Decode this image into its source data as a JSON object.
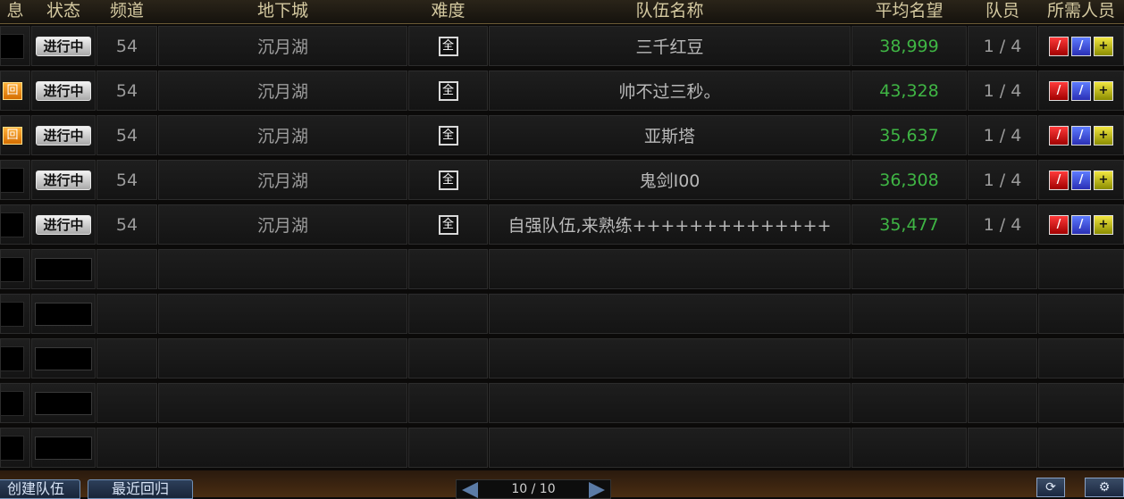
{
  "header": {
    "col_info": "息",
    "col_status": "状态",
    "col_channel": "频道",
    "col_dungeon": "地下城",
    "col_difficulty": "难度",
    "col_team_name": "队伍名称",
    "col_avg_fame": "平均名望",
    "col_members": "队员",
    "col_required": "所需人员"
  },
  "rows": [
    {
      "info": "",
      "status": "进行中",
      "channel": "54",
      "dungeon": "沉月湖",
      "difficulty": "全",
      "team_name": "三千红豆",
      "avg_fame": "38,999",
      "members": "1 / 4"
    },
    {
      "info": "回",
      "status": "进行中",
      "channel": "54",
      "dungeon": "沉月湖",
      "difficulty": "全",
      "team_name": "帅不过三秒。",
      "avg_fame": "43,328",
      "members": "1 / 4"
    },
    {
      "info": "回",
      "status": "进行中",
      "channel": "54",
      "dungeon": "沉月湖",
      "difficulty": "全",
      "team_name": "亚斯塔",
      "avg_fame": "35,637",
      "members": "1 / 4"
    },
    {
      "info": "",
      "status": "进行中",
      "channel": "54",
      "dungeon": "沉月湖",
      "difficulty": "全",
      "team_name": "鬼剑I00",
      "avg_fame": "36,308",
      "members": "1 / 4"
    },
    {
      "info": "",
      "status": "进行中",
      "channel": "54",
      "dungeon": "沉月湖",
      "difficulty": "全",
      "team_name": "自强队伍,来熟练++++++++++++++",
      "avg_fame": "35,477",
      "members": "1 / 4"
    }
  ],
  "empty_rows": 5,
  "footer": {
    "create_team": "创建队伍",
    "recent_return": "最近回归",
    "pagination": "10 / 10"
  },
  "icons": {
    "role_1": "red-sword-icon",
    "role_2": "blue-sword-icon",
    "role_3": "yellow-plus-icon",
    "refresh": "refresh-icon",
    "settings": "gear-icon"
  }
}
